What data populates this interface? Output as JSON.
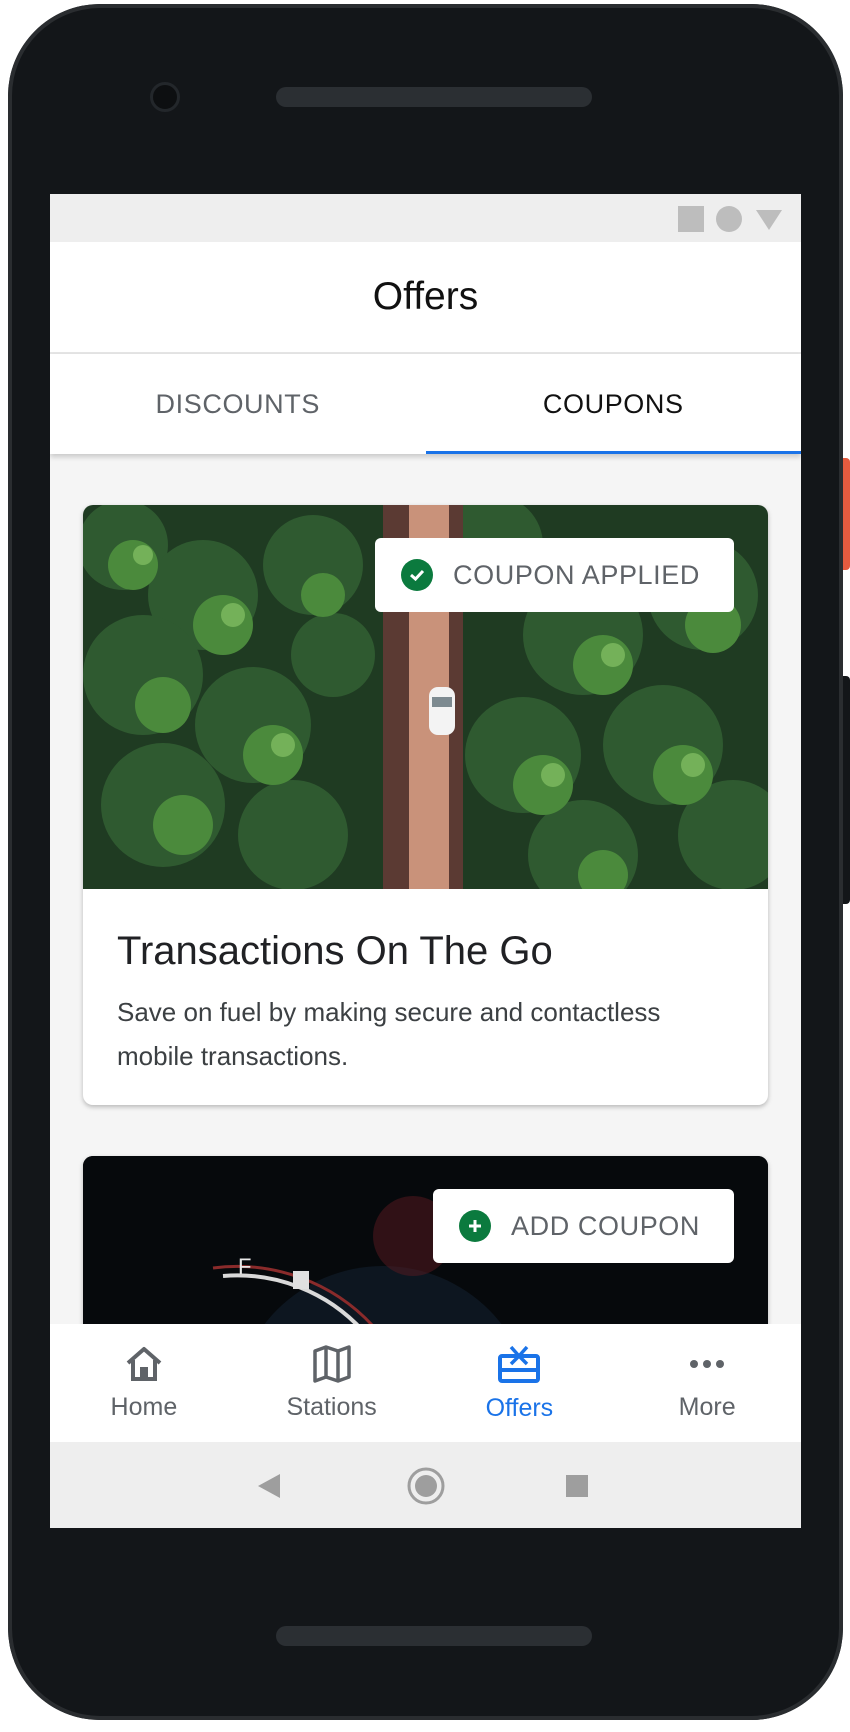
{
  "app": {
    "title": "Offers"
  },
  "tabs": [
    {
      "label": "DISCOUNTS",
      "active": false
    },
    {
      "label": "COUPONS",
      "active": true
    }
  ],
  "cards": [
    {
      "badge": "COUPON APPLIED",
      "badge_icon": "check-circle-icon",
      "title": "Transactions On The Go",
      "description": "Save on fuel by making secure and contactless mobile transactions."
    },
    {
      "badge": "ADD COUPON",
      "badge_icon": "plus-circle-icon"
    }
  ],
  "bottom_nav": [
    {
      "label": "Home",
      "icon": "home-icon",
      "active": false
    },
    {
      "label": "Stations",
      "icon": "map-icon",
      "active": false
    },
    {
      "label": "Offers",
      "icon": "gift-card-icon",
      "active": true
    },
    {
      "label": "More",
      "icon": "more-horizontal-icon",
      "active": false
    }
  ],
  "colors": {
    "accent": "#1a73e8",
    "success": "#0b7a3e",
    "device": "#131619"
  }
}
